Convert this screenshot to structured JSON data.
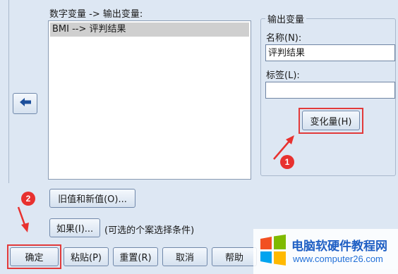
{
  "left_panel": {
    "list_title": "数字变量 -> 输出变量:",
    "list_items": [
      "BMI --> 评判结果"
    ]
  },
  "output_group": {
    "title": "输出变量",
    "name_label": "名称(N):",
    "name_value": "评判结果",
    "label_label": "标签(L):",
    "label_value": "",
    "change_button": "变化量(H)"
  },
  "buttons": {
    "old_new_values": "旧值和新值(O)...",
    "if_button": "如果(I)...",
    "if_hint": "(可选的个案选择条件)",
    "ok": "确定",
    "paste": "粘贴(P)",
    "reset": "重置(R)",
    "cancel": "取消",
    "help": "帮助"
  },
  "annotations": {
    "badge_1": "1",
    "badge_2": "2",
    "accent_color": "#e8312f"
  },
  "watermark": {
    "name": "电脑软硬件教程网",
    "url": "www.computer26.com"
  }
}
